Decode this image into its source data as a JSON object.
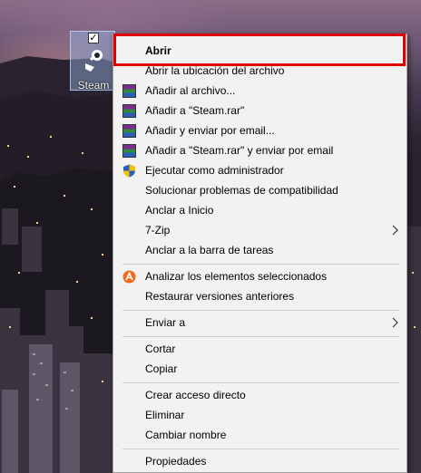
{
  "desktop": {
    "icon_label": "Steam",
    "checkbox_mark": "✓"
  },
  "context_menu": {
    "items": [
      {
        "label": "Abrir",
        "bold": true,
        "icon": "none"
      },
      {
        "label": "Abrir la ubicación del archivo",
        "icon": "none"
      },
      {
        "label": "Añadir al archivo...",
        "icon": "winrar-icon"
      },
      {
        "label": "Añadir a \"Steam.rar\"",
        "icon": "winrar-icon"
      },
      {
        "label": "Añadir y enviar por email...",
        "icon": "winrar-icon"
      },
      {
        "label": "Añadir a \"Steam.rar\" y enviar por email",
        "icon": "winrar-icon"
      },
      {
        "label": "Ejecutar como administrador",
        "icon": "uac-shield-icon"
      },
      {
        "label": "Solucionar problemas de compatibilidad",
        "icon": "none"
      },
      {
        "label": "Anclar a Inicio",
        "icon": "none"
      },
      {
        "label": "7-Zip",
        "icon": "none",
        "submenu": true
      },
      {
        "label": "Anclar a la barra de tareas",
        "icon": "none"
      },
      {
        "label": "Analizar los elementos seleccionados",
        "icon": "antivirus-icon"
      },
      {
        "label": "Restaurar versiones anteriores",
        "icon": "none"
      },
      {
        "label": "Enviar a",
        "icon": "none",
        "submenu": true
      },
      {
        "label": "Cortar",
        "icon": "none"
      },
      {
        "label": "Copiar",
        "icon": "none"
      },
      {
        "label": "Crear acceso directo",
        "icon": "none"
      },
      {
        "label": "Eliminar",
        "icon": "none"
      },
      {
        "label": "Cambiar nombre",
        "icon": "none"
      },
      {
        "label": "Propiedades",
        "icon": "none"
      }
    ]
  },
  "colors": {
    "menu_background": "#f2f2f2",
    "highlight_border": "#e00000",
    "antivirus_orange": "#f26b1d"
  }
}
